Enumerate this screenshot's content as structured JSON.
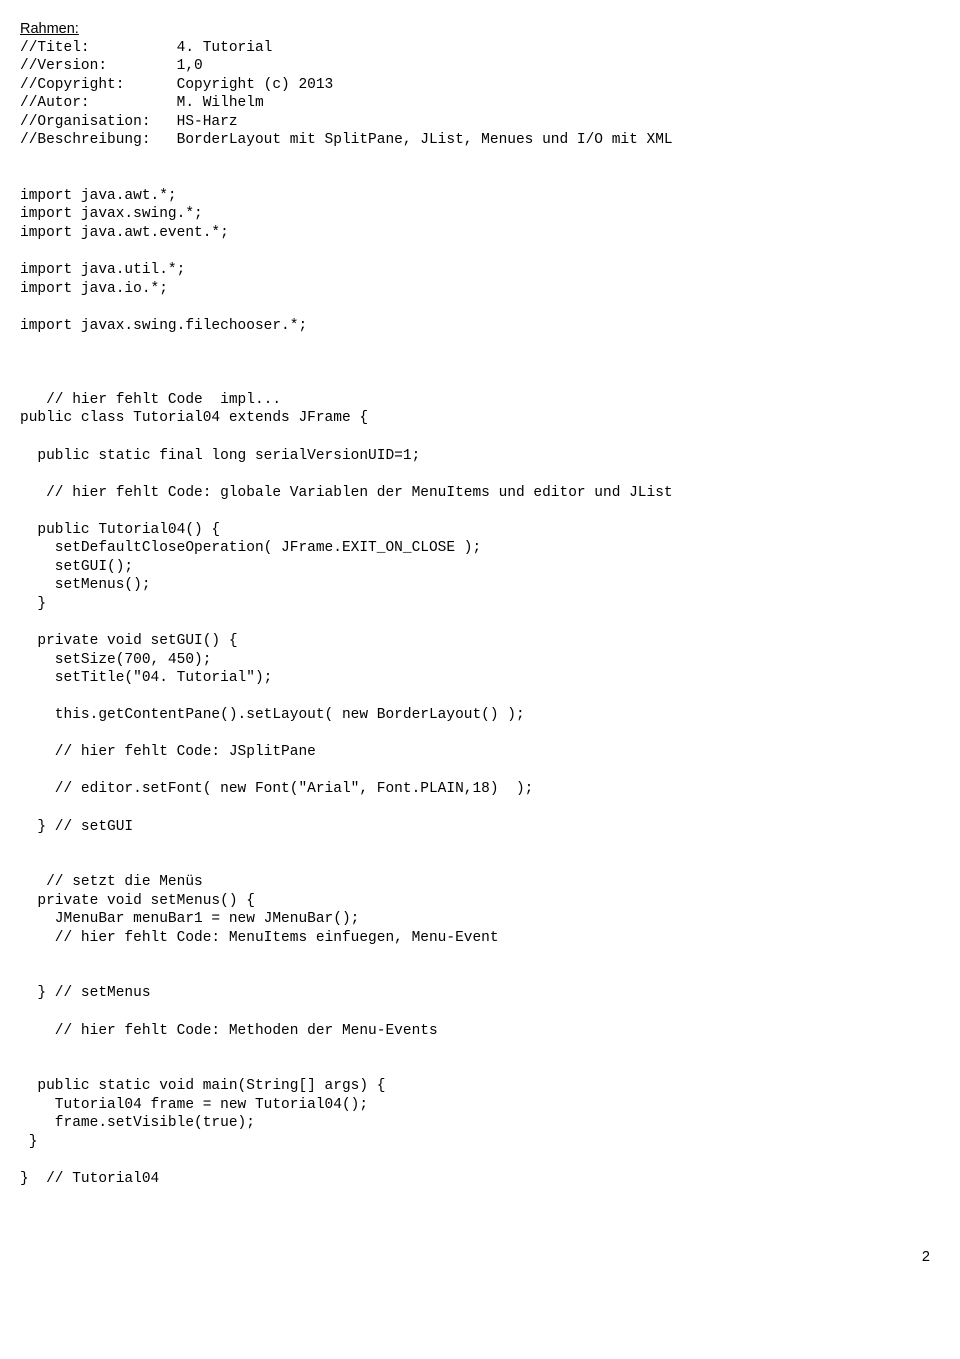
{
  "heading": "Rahmen:",
  "header_block": [
    "//Titel:          4. Tutorial",
    "//Version:        1,0",
    "//Copyright:      Copyright (c) 2013",
    "//Autor:          M. Wilhelm",
    "//Organisation:   HS-Harz",
    "//Beschreibung:   BorderLayout mit SplitPane, JList, Menues und I/O mit XML"
  ],
  "imports1": [
    "import java.awt.*;",
    "import javax.swing.*;",
    "import java.awt.event.*;"
  ],
  "imports2": [
    "import java.util.*;",
    "import java.io.*;"
  ],
  "imports3": [
    "import javax.swing.filechooser.*;"
  ],
  "class_open": [
    "   // hier fehlt Code  impl...",
    "public class Tutorial04 extends JFrame {"
  ],
  "class_body1": [
    "  public static final long serialVersionUID=1;"
  ],
  "class_body2": [
    "   // hier fehlt Code: globale Variablen der MenuItems und editor und JList"
  ],
  "ctor": [
    "  public Tutorial04() {",
    "    setDefaultCloseOperation( JFrame.EXIT_ON_CLOSE );",
    "    setGUI();",
    "    setMenus();",
    "  }"
  ],
  "setgui_top": [
    "  private void setGUI() {",
    "    setSize(700, 450);",
    "    setTitle(\"04. Tutorial\");"
  ],
  "setgui_mid1": [
    "    this.getContentPane().setLayout( new BorderLayout() );"
  ],
  "setgui_mid2": [
    "    // hier fehlt Code: JSplitPane"
  ],
  "setgui_mid3": [
    "    // editor.setFont( new Font(\"Arial\", Font.PLAIN,18)  );"
  ],
  "setgui_end": [
    "  } // setGUI"
  ],
  "setmenus": [
    "   // setzt die Menüs",
    "  private void setMenus() {",
    "    JMenuBar menuBar1 = new JMenuBar();",
    "    // hier fehlt Code: MenuItems einfuegen, Menu-Event"
  ],
  "setmenus_close": [
    "  } // setMenus"
  ],
  "events_todo": [
    "    // hier fehlt Code: Methoden der Menu-Events"
  ],
  "main": [
    "  public static void main(String[] args) {",
    "    Tutorial04 frame = new Tutorial04();",
    "    frame.setVisible(true);",
    " }"
  ],
  "class_close": [
    "}  // Tutorial04"
  ],
  "page_number": "2"
}
